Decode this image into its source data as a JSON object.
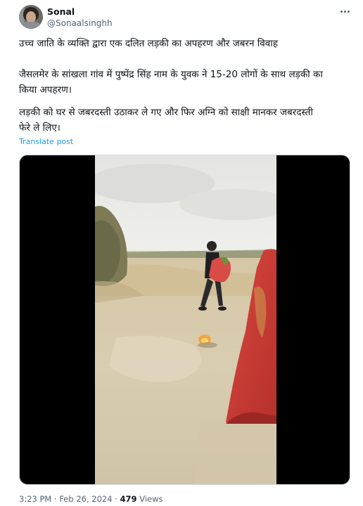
{
  "user": {
    "name": "Sonal",
    "handle": "@Sonaalsinghh"
  },
  "tweet": {
    "line1": "उच्च जाति के व्यक्ति द्वारा एक दलित लड़की का अपहरण और जबरन विवाह",
    "line2a": "जैसलमेर के सांखला गांव में पुष्पेंद्र सिंह नाम के युवक ने 15-20 लोगों के साथ लड़की का",
    "line2b": "किया अपहरण।",
    "line3a": "लड़की को घर से जबरदस्ती उठाकर ले गए और फिर अग्नि को साक्षी मानकर जबरदस्ती",
    "line3b": "फेरे ले लिए।",
    "translate_label": "Translate post"
  },
  "footer": {
    "time": "3:23 PM",
    "separator1": "·",
    "date": "Feb 26, 2024",
    "separator2": "·",
    "views_count": "479",
    "views_label": "Views"
  },
  "icons": {
    "more": "more-horizontal-icon"
  }
}
